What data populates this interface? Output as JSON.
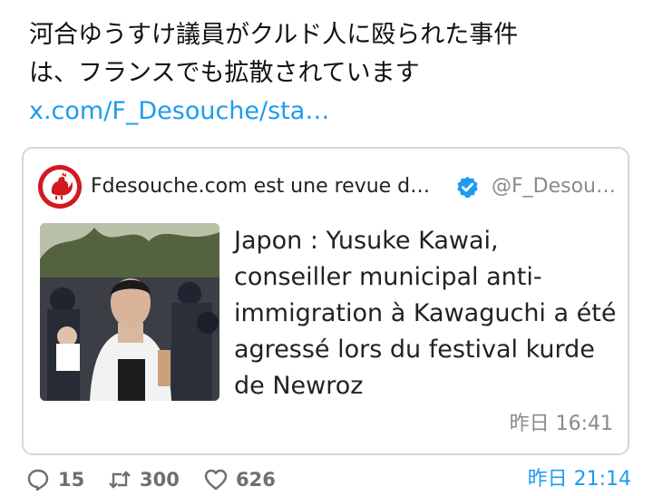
{
  "post": {
    "lines": [
      "河合ゆうすけ議員がクルド人に殴られた事件",
      "は、フランスでも拡散されています"
    ],
    "link": "x.com/F_Desouche/sta…"
  },
  "quoted": {
    "display_name": "Fdesouche.com est une revue de p…",
    "handle": "@F_Desou…",
    "text_lines": [
      "Japon : Yusuke Kawai,",
      "conseiller municipal anti-",
      "immigration à Kawaguchi a été",
      "agressé lors du festival kurde",
      "de Newroz"
    ],
    "timestamp": "昨日 16:41",
    "avatar_icon": "rooster-logo-icon",
    "verified_icon": "verified-badge-icon"
  },
  "actions": {
    "replies": "15",
    "reposts": "300",
    "likes": "626",
    "timestamp": "昨日 21:14"
  },
  "colors": {
    "link": "#1d9bf0",
    "muted": "#6e6e6e",
    "avatar_bg": "#d11a1f",
    "border": "#d6d6d6"
  }
}
